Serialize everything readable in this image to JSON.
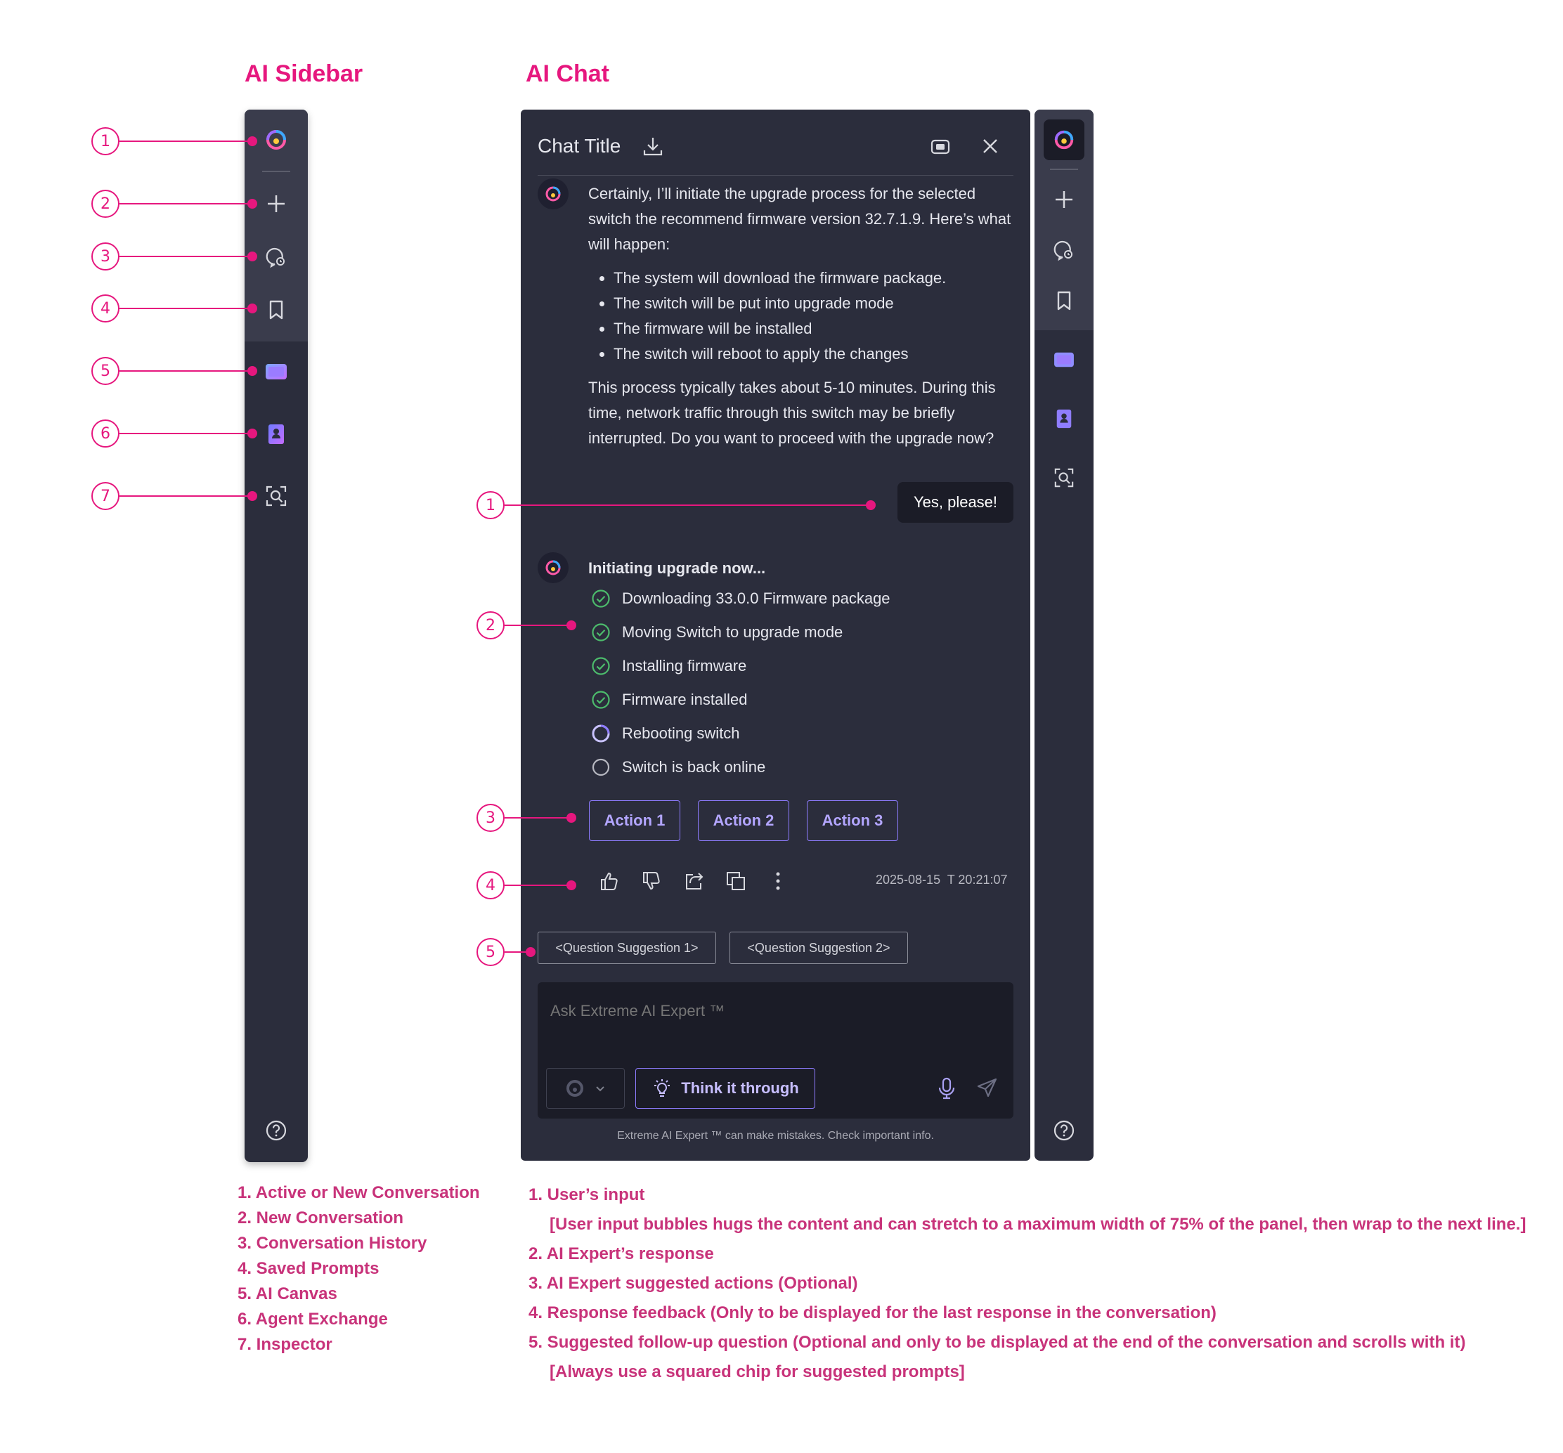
{
  "headings": {
    "sidebar": "AI Sidebar",
    "chat": "AI Chat"
  },
  "markers": {
    "sidebar": [
      "1",
      "2",
      "3",
      "4",
      "5",
      "6",
      "7"
    ],
    "chat": [
      "1",
      "2",
      "3",
      "4",
      "5"
    ]
  },
  "chat": {
    "title": "Chat Title",
    "ai_message": {
      "intro": "Certainly, I’ll initiate the upgrade process for the selected switch the recommend firmware version 32.7.1.9. Here’s what will happen:",
      "bullets": [
        "The system will download the firmware package.",
        "The switch will be put into upgrade mode",
        "The firmware will be installed",
        "The switch will reboot to apply the changes"
      ],
      "outro": "This process typically takes about 5-10 minutes. During this time, network traffic through this switch may be briefly interrupted. Do you want to proceed with the upgrade now?"
    },
    "user_message": "Yes, please!",
    "progress": {
      "title": "Initiating upgrade now...",
      "steps": [
        {
          "label": "Downloading 33.0.0 Firmware package",
          "status": "done"
        },
        {
          "label": "Moving Switch to upgrade mode",
          "status": "done"
        },
        {
          "label": "Installing firmware",
          "status": "done"
        },
        {
          "label": "Firmware installed",
          "status": "done"
        },
        {
          "label": "Rebooting switch",
          "status": "in-progress"
        },
        {
          "label": "Switch is back online",
          "status": "pending"
        }
      ]
    },
    "actions": [
      "Action 1",
      "Action 2",
      "Action 3"
    ],
    "timestamp": "2025-08-15  T 20:21:07",
    "suggestions": [
      "<Question Suggestion 1>",
      "<Question Suggestion 2>"
    ],
    "input": {
      "placeholder": "Ask Extreme AI Expert ™",
      "think_label": "Think it through",
      "disclaimer": "Extreme AI Expert ™ can make mistakes. Check important info."
    }
  },
  "sidebar_notes": [
    "1. Active or New Conversation",
    "2. New Conversation",
    "3. Conversation History",
    "4. Saved Prompts",
    "5. AI Canvas",
    "6. Agent Exchange",
    "7. Inspector"
  ],
  "chat_notes": [
    "1. User’s input",
    "[User input bubbles hugs the content and can stretch to a maximum width of 75% of the panel, then wrap to the next line.]",
    "2. AI Expert’s response",
    "3. AI Expert suggested actions (Optional)",
    "4. Response feedback (Only to be displayed for the last response in the conversation)",
    "5. Suggested follow-up question (Optional and only to be displayed at the end of the conversation and scrolls with it)",
    "[Always use a squared chip for suggested prompts]"
  ],
  "colors": {
    "accent": "#e6177e",
    "panel": "#2b2d3c",
    "purple": "#8e7cff",
    "success": "#4cbb6c"
  },
  "icons": {
    "sidebar": [
      "logo-icon",
      "plus-icon",
      "history-icon",
      "bookmark-icon",
      "canvas-icon",
      "agent-exchange-icon",
      "inspector-icon",
      "help-icon"
    ],
    "header": [
      "download-icon",
      "minimize-icon",
      "close-icon"
    ],
    "feedback": [
      "thumbs-up-icon",
      "thumbs-down-icon",
      "share-icon",
      "copy-icon",
      "more-icon"
    ],
    "input": [
      "model-icon",
      "chevron-down-icon",
      "lightbulb-icon",
      "microphone-icon",
      "send-icon"
    ]
  }
}
